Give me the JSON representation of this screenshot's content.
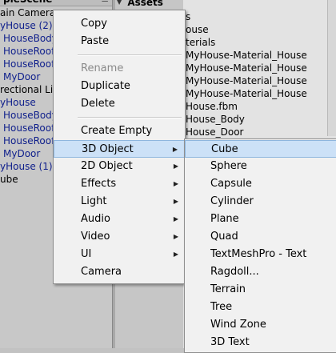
{
  "hierarchy": {
    "title": "pleScene",
    "menu_icon": "≡",
    "items": [
      {
        "label": "ain Camera",
        "blue": false
      },
      {
        "label": "yHouse (2)",
        "blue": true
      },
      {
        "label": "HouseBody",
        "blue": true
      },
      {
        "label": "HouseRoof-",
        "blue": true
      },
      {
        "label": "HouseRoof_",
        "blue": true
      },
      {
        "label": "MyDoor",
        "blue": true
      },
      {
        "label": "rectional Lig",
        "blue": false
      },
      {
        "label": "yHouse",
        "blue": true
      },
      {
        "label": "HouseBody",
        "blue": true
      },
      {
        "label": "HouseRoof-",
        "blue": true
      },
      {
        "label": "HouseRoof_",
        "blue": true
      },
      {
        "label": "MyDoor",
        "blue": true
      },
      {
        "label": "yHouse (1)",
        "blue": true
      },
      {
        "label": "ube",
        "blue": false
      }
    ]
  },
  "project": {
    "assets_label": "Assets",
    "items": [
      "s",
      "ouse",
      "terials",
      "MyHouse-Material_House",
      "MyHouse-Material_House",
      "MyHouse-Material_House",
      "MyHouse-Material_House",
      "House.fbm",
      "House_Body",
      "House_Door"
    ]
  },
  "context_menu": {
    "items": [
      {
        "label": "Copy",
        "disabled": false,
        "submenu": false,
        "highlighted": false
      },
      {
        "label": "Paste",
        "disabled": false,
        "submenu": false,
        "highlighted": false
      },
      {
        "separator": true
      },
      {
        "label": "Rename",
        "disabled": true,
        "submenu": false,
        "highlighted": false
      },
      {
        "label": "Duplicate",
        "disabled": false,
        "submenu": false,
        "highlighted": false
      },
      {
        "label": "Delete",
        "disabled": false,
        "submenu": false,
        "highlighted": false
      },
      {
        "separator": true
      },
      {
        "label": "Create Empty",
        "disabled": false,
        "submenu": false,
        "highlighted": false
      },
      {
        "label": "3D Object",
        "disabled": false,
        "submenu": true,
        "highlighted": true
      },
      {
        "label": "2D Object",
        "disabled": false,
        "submenu": true,
        "highlighted": false
      },
      {
        "label": "Effects",
        "disabled": false,
        "submenu": true,
        "highlighted": false
      },
      {
        "label": "Light",
        "disabled": false,
        "submenu": true,
        "highlighted": false
      },
      {
        "label": "Audio",
        "disabled": false,
        "submenu": true,
        "highlighted": false
      },
      {
        "label": "Video",
        "disabled": false,
        "submenu": true,
        "highlighted": false
      },
      {
        "label": "UI",
        "disabled": false,
        "submenu": true,
        "highlighted": false
      },
      {
        "label": "Camera",
        "disabled": false,
        "submenu": false,
        "highlighted": false
      }
    ]
  },
  "submenu_3d_object": {
    "items": [
      {
        "label": "Cube",
        "highlighted": true
      },
      {
        "label": "Sphere",
        "highlighted": false
      },
      {
        "label": "Capsule",
        "highlighted": false
      },
      {
        "label": "Cylinder",
        "highlighted": false
      },
      {
        "label": "Plane",
        "highlighted": false
      },
      {
        "label": "Quad",
        "highlighted": false
      },
      {
        "label": "TextMeshPro - Text",
        "highlighted": false
      },
      {
        "label": "Ragdoll...",
        "highlighted": false
      },
      {
        "label": "Terrain",
        "highlighted": false
      },
      {
        "label": "Tree",
        "highlighted": false
      },
      {
        "label": "Wind Zone",
        "highlighted": false
      },
      {
        "label": "3D Text",
        "highlighted": false
      }
    ]
  },
  "colors": {
    "menu_highlight": "#cce1f7",
    "hierarchy_prefab_text": "#10208c"
  }
}
